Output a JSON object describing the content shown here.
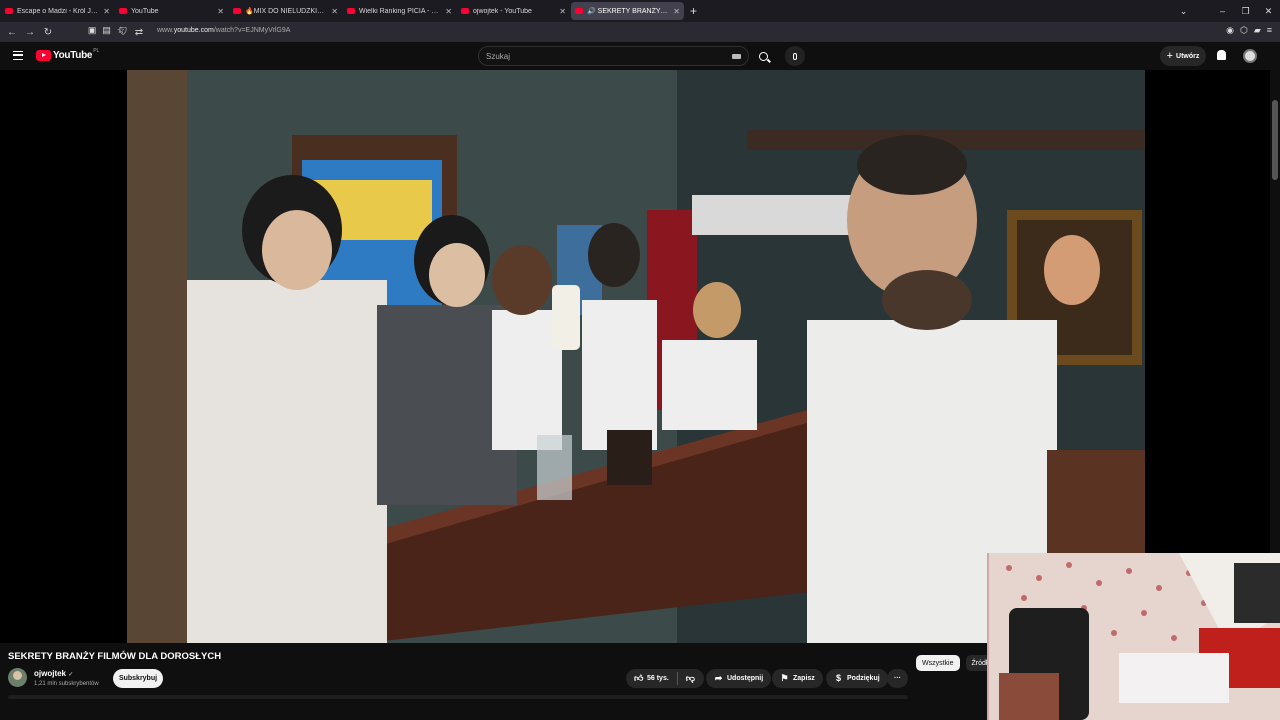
{
  "browser": {
    "tabs": [
      {
        "label": "Escape o Madzi - Król Julian & I",
        "active": false
      },
      {
        "label": "YouTube",
        "active": false
      },
      {
        "label": "🔥MIX DO NIELUDZKIEJ PRACY",
        "active": false
      },
      {
        "label": "Wielki Ranking PICIA - CZEGO N",
        "active": false
      },
      {
        "label": "ojwojtek - YouTube",
        "active": false
      },
      {
        "label": "🔊 SEKRETY BRANŻY FILMÓW",
        "active": true
      }
    ],
    "new_tab_label": "+",
    "url_prefix": "www.",
    "url_host": "youtube.com",
    "url_path": "/watch?v=EJNMyVrlG9A"
  },
  "youtube": {
    "logo_text": "YouTube",
    "logo_region": "PL",
    "search_placeholder": "Szukaj",
    "create_label": "Utwórz"
  },
  "video": {
    "title": "SEKRETY BRANŻY FILMÓW DLA DOROSŁYCH",
    "channel_name": "ojwojtek",
    "verified_glyph": "✓",
    "subscribers": "1,21 mln subskrybentów",
    "subscribe_label": "Subskrybuj",
    "likes": "56 tys.",
    "share_label": "Udostępnij",
    "save_label": "Zapisz",
    "thanks_label": "Podziękuj",
    "more_label": "···"
  },
  "filters": [
    {
      "label": "Wszystkie",
      "selected": true
    },
    {
      "label": "Źródło",
      "selected": false
    }
  ],
  "colors": {
    "brand_red": "#ff0033",
    "background": "#0f0f0f",
    "pill": "#272727"
  },
  "icons": [
    "menu-icon",
    "search-icon",
    "mic-icon",
    "plus-icon",
    "bell-icon",
    "like-icon",
    "dislike-icon",
    "share-icon",
    "save-icon",
    "thanks-icon",
    "more-icon"
  ]
}
